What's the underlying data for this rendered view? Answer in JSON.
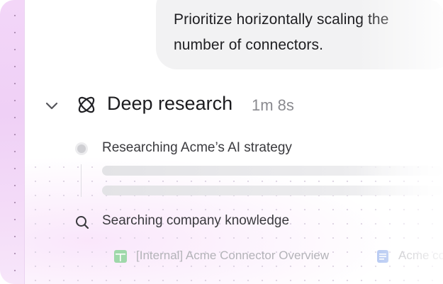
{
  "message": {
    "text": "Prioritize horizontally scaling the number of connectors."
  },
  "research": {
    "title": "Deep research",
    "duration": "1m 8s",
    "steps": [
      {
        "label": "Researching Acme’s AI strategy",
        "icon": "progress-dot-icon"
      },
      {
        "label": "Searching company knowledge",
        "icon": "search-icon"
      }
    ],
    "sources": [
      {
        "label": "[Internal] Acme Connector Overview",
        "icon": "spreadsheet-icon",
        "color": "#8fcf9b"
      },
      {
        "label": "Acme co",
        "icon": "document-icon",
        "color": "#8aa9e6"
      }
    ]
  },
  "colors": {
    "accent_pink": "#efd0f6",
    "bubble_bg": "#f2f2f3",
    "muted_text": "#8a8a8f"
  }
}
